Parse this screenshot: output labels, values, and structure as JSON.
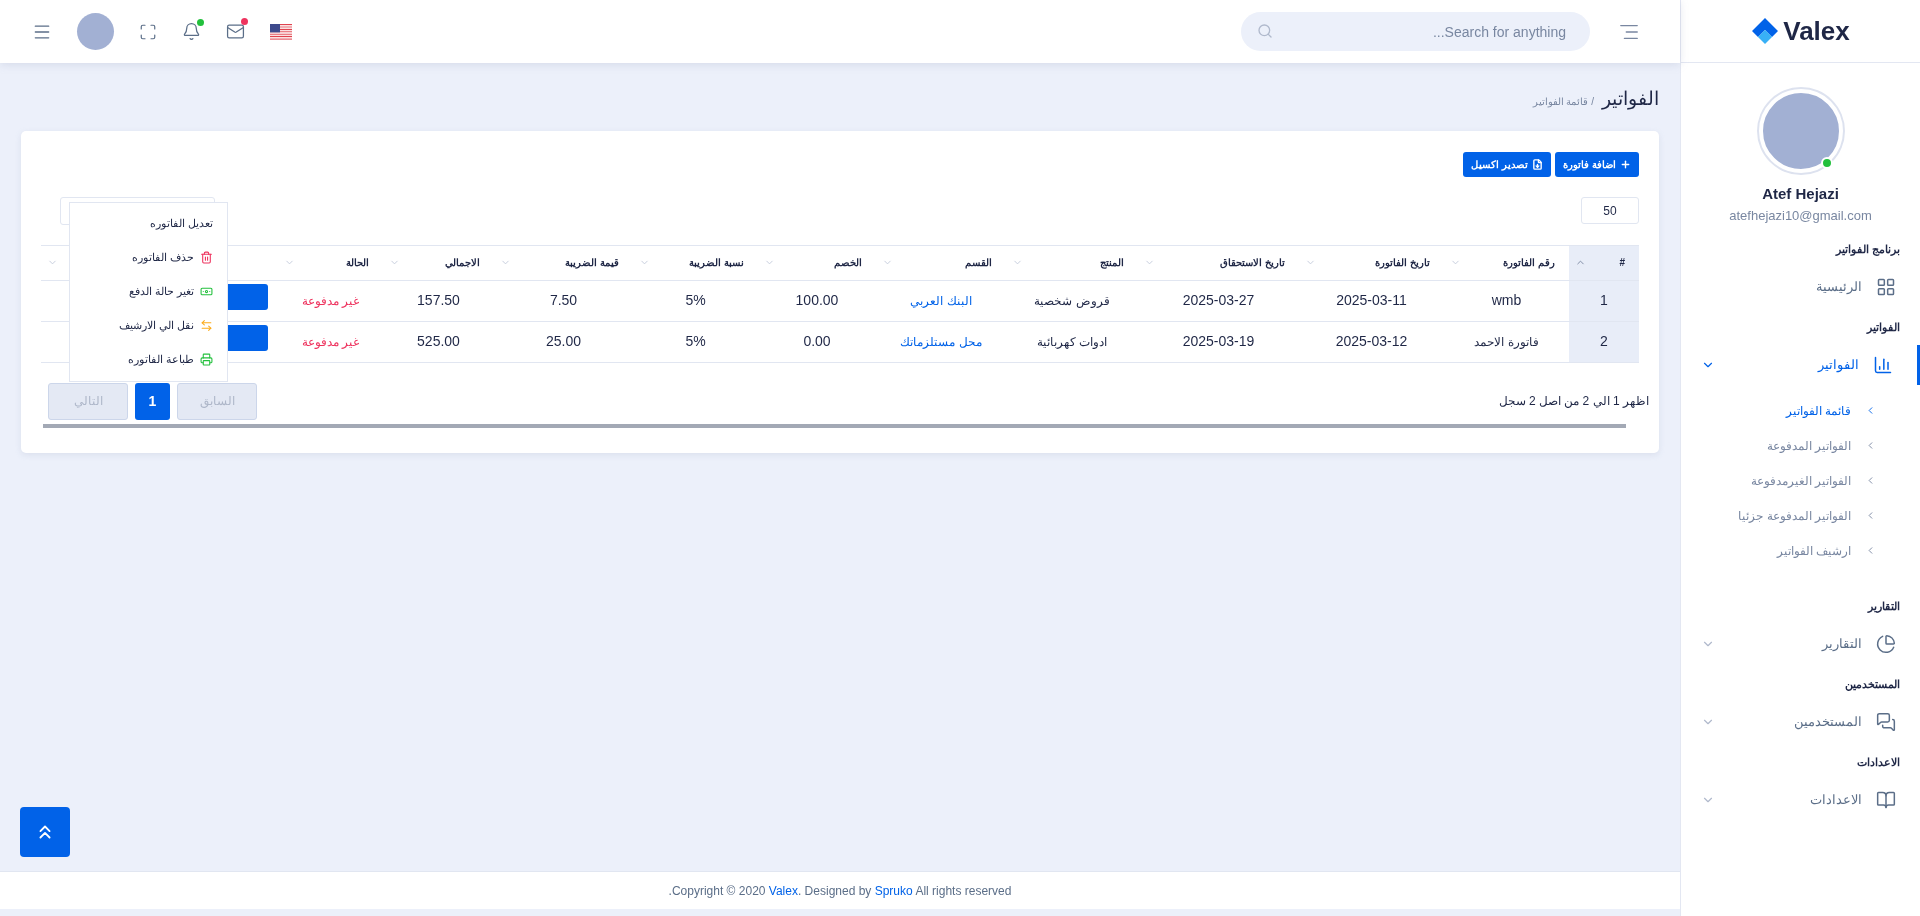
{
  "topbar": {
    "search": {
      "placeholder": "...Search for anything"
    }
  },
  "sidebar": {
    "logo": "Valex",
    "user": {
      "name": "Atef Hejazi",
      "email": "atefhejazi10@gmail.com",
      "online": true
    },
    "sections": [
      {
        "title": "برنامج الفواتير",
        "items": [
          {
            "label": "الرئيسية",
            "selected": false
          }
        ]
      },
      {
        "title": "الفواتير",
        "items": [
          {
            "label": "الفواتير",
            "selected": true,
            "expanded": true,
            "children": [
              {
                "label": "قائمة الفواتير",
                "selected": true
              },
              {
                "label": "الفواتير المدفوعة",
                "selected": false
              },
              {
                "label": "الفواتير الغيرمدفوعة",
                "selected": false
              },
              {
                "label": "الفواتير المدفوعة جزئيا",
                "selected": false
              },
              {
                "label": "ارشيف الفواتير",
                "selected": false
              }
            ]
          }
        ]
      },
      {
        "title": "التقارير",
        "items": [
          {
            "label": "التقارير",
            "selected": false,
            "expanded": false
          }
        ]
      },
      {
        "title": "المستخدمين",
        "items": [
          {
            "label": "المستخدمين",
            "selected": false,
            "expanded": false
          }
        ]
      },
      {
        "title": "الاعدادات",
        "items": [
          {
            "label": "الاعدادات",
            "selected": false,
            "expanded": false
          }
        ]
      }
    ]
  },
  "page": {
    "title": "الفواتير",
    "breadcrumb": "/ قائمة الفواتير"
  },
  "toolbar": {
    "buttons": [
      "اضافة فاتورة",
      "تصدير اكسيل"
    ],
    "page_length": "50"
  },
  "table": {
    "columns": [
      {
        "label": "#",
        "kind": "index",
        "sorted": true
      },
      {
        "label": "رقم الفاتورة",
        "kind": "text",
        "sorted": false
      },
      {
        "label": "تاريخ الفاتورة",
        "kind": "text",
        "sorted": false
      },
      {
        "label": "تاريخ الاستحقاق",
        "kind": "text",
        "sorted": false
      },
      {
        "label": "المنتج",
        "kind": "text",
        "sorted": false
      },
      {
        "label": "القسم",
        "kind": "link",
        "sorted": false
      },
      {
        "label": "الخصم",
        "kind": "text",
        "sorted": false
      },
      {
        "label": "نسبة الضريبة",
        "kind": "text",
        "sorted": false
      },
      {
        "label": "قيمة الضريبة",
        "kind": "text",
        "sorted": false
      },
      {
        "label": "الاجمالي",
        "kind": "text",
        "sorted": false
      },
      {
        "label": "الحالة",
        "kind": "status",
        "sorted": false
      },
      {
        "kind": "action",
        "sorted": false
      }
    ],
    "rows": [
      {
        "cells": [
          "1",
          "wmb",
          "2025-03-11",
          "2025-03-27",
          "قروض شخصية",
          "البنك العربي",
          "100.00",
          "5%",
          "7.50",
          "157.50",
          "غير مدفوعة"
        ]
      },
      {
        "cells": [
          "2",
          "فاتورة الاحمد",
          "2025-03-12",
          "2025-03-19",
          "ادوات كهربائية",
          "محل مستلزماتك",
          "0.00",
          "5%",
          "25.00",
          "525.00",
          "غير مدفوعة"
        ]
      }
    ]
  },
  "menu": {
    "items": [
      {
        "label": "تعديل الفاتوره"
      },
      {
        "label": "حذف الفاتوره"
      },
      {
        "label": "تغير حالة الدفع"
      },
      {
        "label": "نقل الي الارشيف"
      },
      {
        "label": "طباعة الفاتوره"
      }
    ]
  },
  "pagination": {
    "info": "اظهر 1 الي 2 من اصل 2 سجل",
    "previous": {
      "label": "السابق",
      "disabled": true
    },
    "pages": [
      {
        "label": "1",
        "selected": true
      }
    ],
    "next": {
      "label": "التالي",
      "disabled": true
    }
  },
  "footer": {
    "before": ".Copyright © 2020 ",
    "brand": "Valex",
    "middle": ". Designed by ",
    "author": "Spruko",
    "after": " All rights reserved"
  }
}
